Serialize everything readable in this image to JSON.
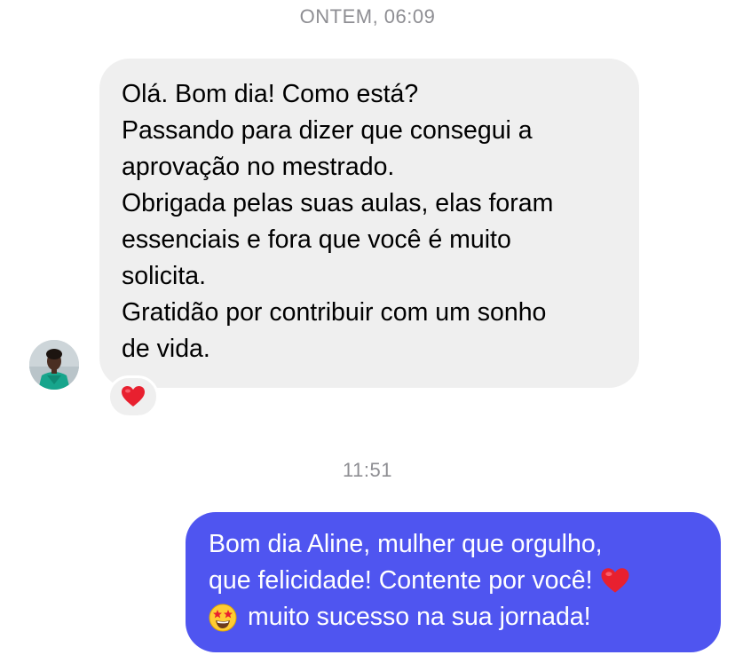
{
  "conversation": {
    "timestamp_1": "ONTEM, 06:09",
    "timestamp_2": "11:51",
    "incoming": {
      "avatar": "contact-avatar-photo",
      "lines": [
        "Olá. Bom dia! Como está?",
        "Passando para dizer que consegui a",
        "aprovação no mestrado.",
        "Obrigada pelas suas aulas, elas foram",
        "essenciais e fora que você é muito",
        "solicita.",
        "Gratidão por contribuir com um sonho",
        "de vida."
      ],
      "reaction": "red-heart-emoji"
    },
    "outgoing": {
      "line1": "Bom dia Aline, mulher que orgulho,",
      "line2": "que felicidade! Contente por você!",
      "line3": "muito sucesso na sua jornada!",
      "emoji_after_line2": "red-heart-emoji",
      "emoji_before_line3": "star-struck-emoji"
    }
  },
  "colors": {
    "incoming_bubble": "#efefef",
    "outgoing_bubble": "#4f55f0",
    "timestamp": "#8e8e93",
    "heart": "#e8202f"
  }
}
